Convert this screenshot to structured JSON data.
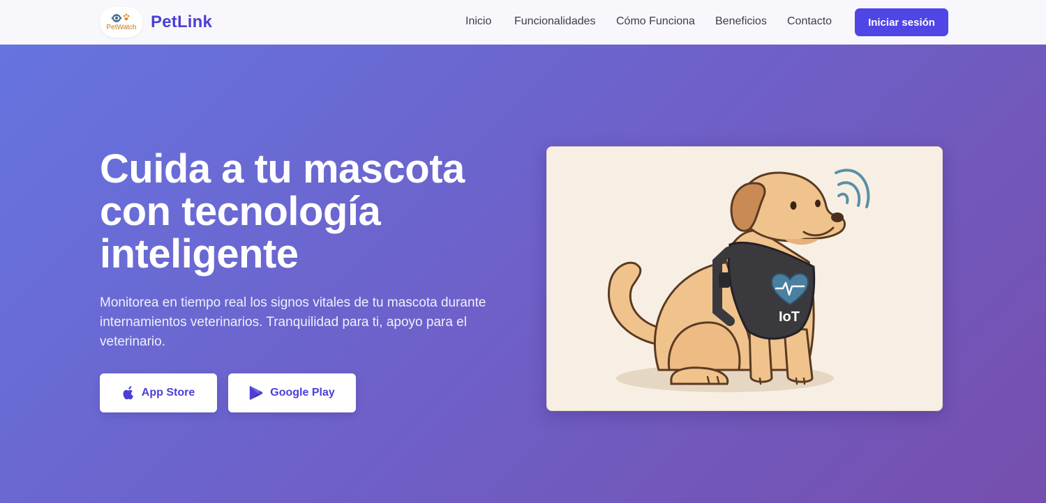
{
  "navbar": {
    "logo_text": "PetWatch",
    "brand": "PetLink",
    "links": [
      {
        "label": "Inicio"
      },
      {
        "label": "Funcionalidades"
      },
      {
        "label": "Cómo Funciona"
      },
      {
        "label": "Beneficios"
      },
      {
        "label": "Contacto"
      }
    ],
    "login_label": "Iniciar sesión"
  },
  "hero": {
    "title_lines": [
      "Cuida a tu mascota",
      "con tecnología",
      "inteligente"
    ],
    "subtitle": "Monitorea en tiempo real los signos vitales de tu mascota durante internamientos veterinarios. Tranquilidad para ti, apoyo para el veterinario.",
    "buttons": {
      "app_store": {
        "label": "App Store",
        "icon": "apple-icon"
      },
      "google_play": {
        "label": "Google Play",
        "icon": "play-store-icon"
      }
    },
    "illustration": {
      "vest_label": "IoT",
      "subject": "dog-with-iot-vest"
    }
  },
  "colors": {
    "brand": "#4b3fd6",
    "button": "#4f46e5",
    "hero_gradient_start": "#6674e0",
    "hero_gradient_end": "#764fae",
    "illustration_bg": "#f8efe4"
  }
}
